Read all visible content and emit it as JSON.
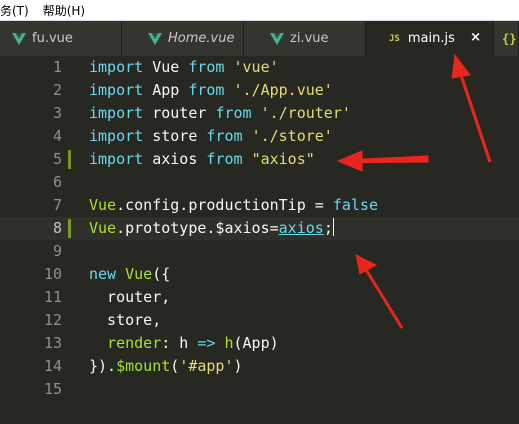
{
  "menu": {
    "items": [
      "任务(T)",
      "帮助(H)"
    ]
  },
  "tabs": [
    {
      "label": "fu.vue",
      "icon": "vue-icon"
    },
    {
      "label": "Home.vue",
      "icon": "vue-icon",
      "italic": true
    },
    {
      "label": "zi.vue",
      "icon": "vue-icon"
    },
    {
      "label": "main.js",
      "icon": "js-icon",
      "icon_text": "JS",
      "active": true,
      "close": "×"
    },
    {
      "label": "",
      "icon": "json-icon",
      "icon_text": "{}"
    }
  ],
  "editor": {
    "line_numbers": [
      "1",
      "2",
      "3",
      "4",
      "5",
      "6",
      "7",
      "8",
      "9",
      "10",
      "11",
      "12",
      "13",
      "14",
      "15"
    ],
    "lines": [
      "import Vue from 'vue'",
      "import App from './App.vue'",
      "import router from './router'",
      "import store from './store'",
      "import axios from \"axios\"",
      "",
      "Vue.config.productionTip = false",
      "Vue.prototype.$axios=axios;",
      "",
      "new Vue({",
      "  router,",
      "  store,",
      "  render: h => h(App)",
      "}).$mount('#app')",
      ""
    ],
    "current_line": 8
  },
  "colors": {
    "background": "#272822",
    "keyword": "#66d9ef",
    "string": "#e6db74",
    "entity": "#a6e22e",
    "annotation_arrow": "#e8261f"
  }
}
